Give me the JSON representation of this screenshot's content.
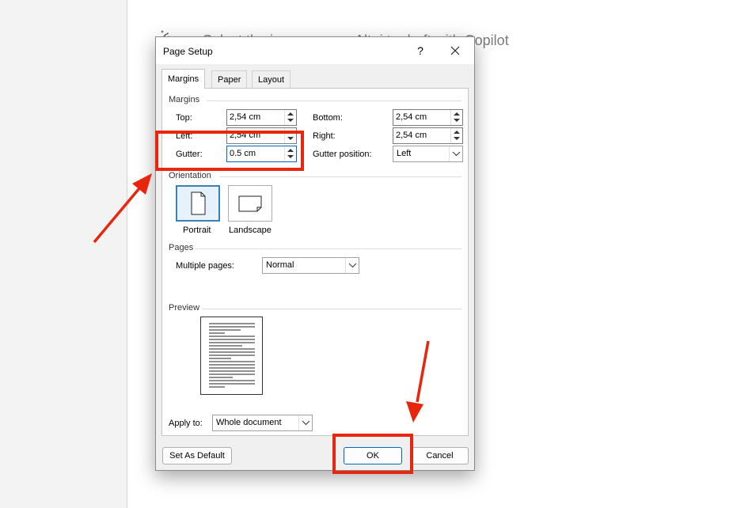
{
  "doc": {
    "copilot_hint": "Select the icon or press Alt+i to draft with Copilot"
  },
  "dialog": {
    "title": "Page Setup",
    "help": "?",
    "tabs": [
      {
        "label": "Margins",
        "active": true
      },
      {
        "label": "Paper",
        "active": false
      },
      {
        "label": "Layout",
        "active": false
      }
    ],
    "margins": {
      "group_label": "Margins",
      "top": {
        "label": "Top:",
        "value": "2,54 cm"
      },
      "bottom": {
        "label": "Bottom:",
        "value": "2,54 cm"
      },
      "left": {
        "label": "Left:",
        "value": "2,54 cm"
      },
      "right": {
        "label": "Right:",
        "value": "2,54 cm"
      },
      "gutter": {
        "label": "Gutter:",
        "value": "0.5 cm"
      },
      "gutter_position": {
        "label": "Gutter position:",
        "value": "Left"
      }
    },
    "orientation": {
      "group_label": "Orientation",
      "portrait": "Portrait",
      "landscape": "Landscape",
      "selected": "Portrait"
    },
    "pages": {
      "group_label": "Pages",
      "multiple_pages_label": "Multiple pages:",
      "multiple_pages_value": "Normal"
    },
    "preview": {
      "group_label": "Preview"
    },
    "apply_to": {
      "label": "Apply to:",
      "value": "Whole document"
    },
    "buttons": {
      "set_default": "Set As Default",
      "ok": "OK",
      "cancel": "Cancel"
    }
  },
  "annotations": {
    "color": "#e8260e"
  }
}
